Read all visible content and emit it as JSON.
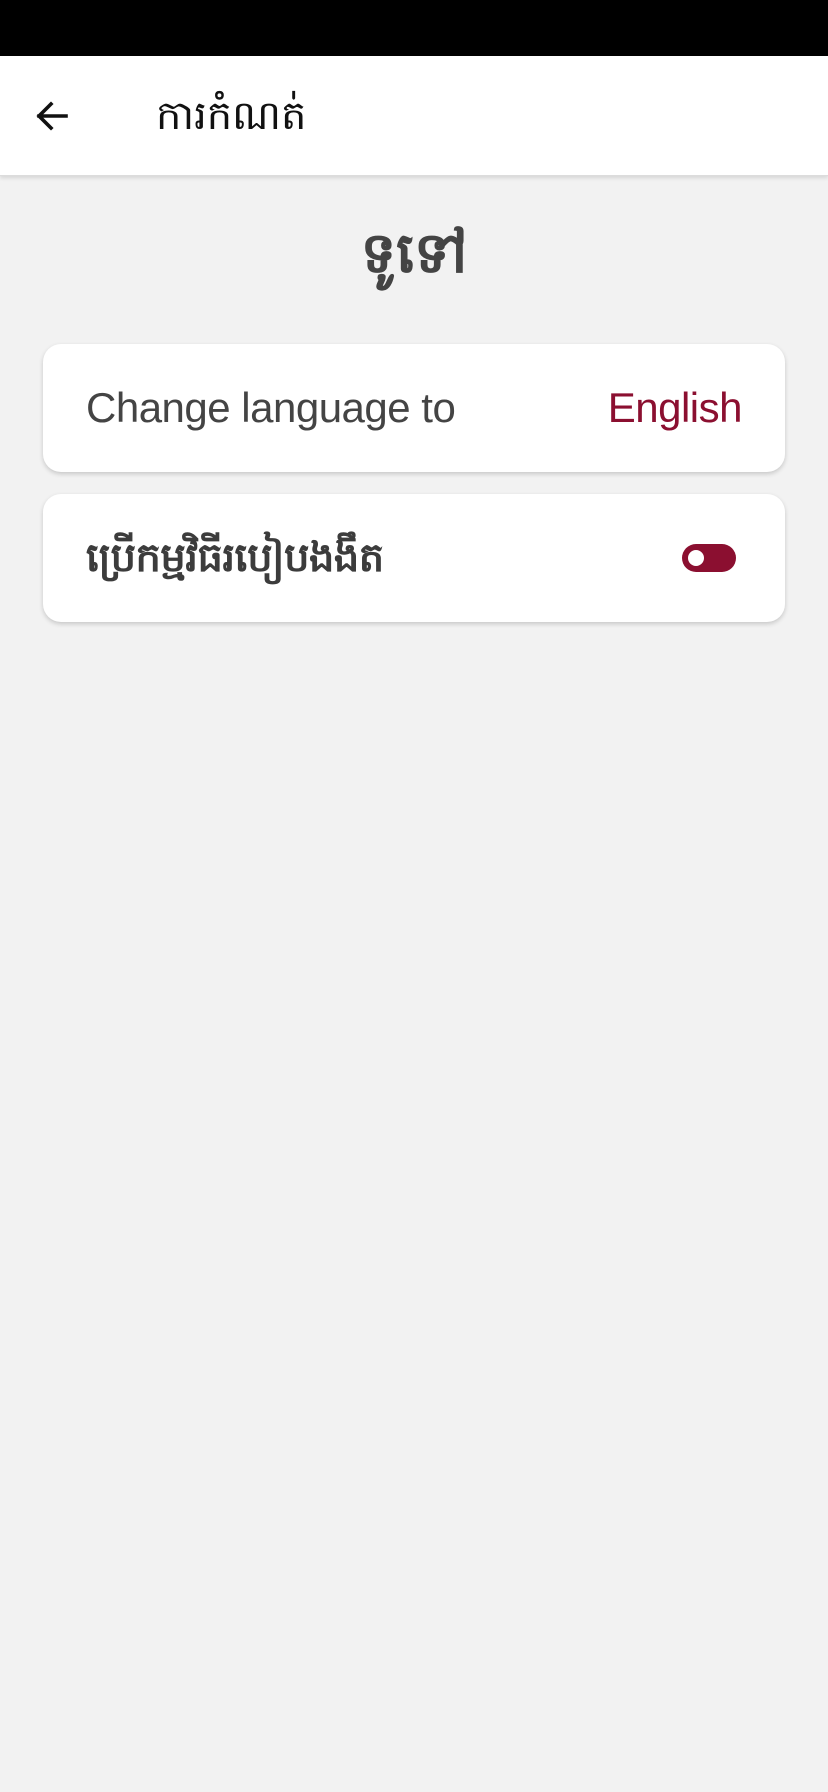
{
  "header": {
    "title": "ការកំណត់",
    "back_icon": "arrow-left-icon"
  },
  "section": {
    "heading": "ទូទៅ"
  },
  "settings": {
    "language": {
      "label": "Change language to",
      "value": "English"
    },
    "dark_mode": {
      "label": "ប្រើកម្មវិធីរបៀបងងឹត",
      "enabled": false
    }
  },
  "colors": {
    "accent": "#8b0f30",
    "background": "#f2f2f2",
    "text": "#444444"
  }
}
